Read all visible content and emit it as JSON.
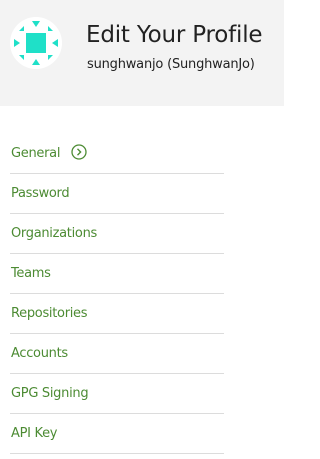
{
  "header": {
    "title": "Edit Your Profile",
    "subtitle": "sunghwanjo (SunghwanJo)"
  },
  "colors": {
    "accent": "#4c8b33",
    "avatar": "#1fe0c8",
    "header_bg": "#f3f3f3",
    "divider": "#dcdcdc"
  },
  "nav": {
    "items": [
      {
        "label": "General",
        "icon": "chevron-right-circle-icon"
      },
      {
        "label": "Password"
      },
      {
        "label": "Organizations"
      },
      {
        "label": "Teams"
      },
      {
        "label": "Repositories"
      },
      {
        "label": "Accounts"
      },
      {
        "label": "GPG Signing"
      },
      {
        "label": "API Key"
      }
    ]
  }
}
